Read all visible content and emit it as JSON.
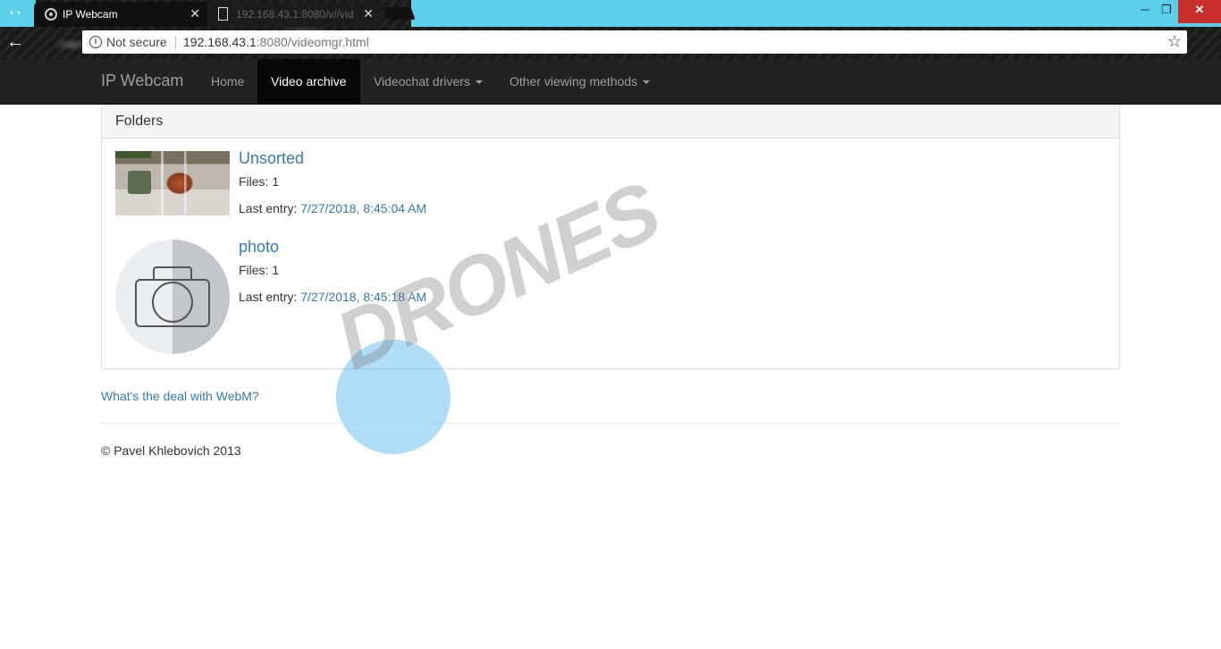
{
  "browser": {
    "tabs": [
      {
        "title": "IP Webcam",
        "active": true
      },
      {
        "title": "192.168.43.1:8080/v//vid",
        "active": false
      }
    ],
    "close_glyph": "✕",
    "address": {
      "security_label": "Not secure",
      "url_host": "192.168.43.1",
      "url_rest": ":8080/videomgr.html"
    },
    "icons": {
      "back": "arrow-left-icon",
      "info": "info-icon",
      "star": "star-icon",
      "favicon": "webcam-icon",
      "document": "document-icon"
    },
    "window_controls": {
      "minimize": "─",
      "maximize": "❐",
      "close": "✕"
    },
    "title_bar_color": "#5ccfea"
  },
  "navbar": {
    "brand": "IP Webcam",
    "items": [
      {
        "label": "Home",
        "active": false
      },
      {
        "label": "Video archive",
        "active": true
      },
      {
        "label": "Videochat drivers",
        "active": false,
        "dropdown": true
      },
      {
        "label": "Other viewing methods",
        "active": false,
        "dropdown": true
      }
    ]
  },
  "panel": {
    "title": "Folders",
    "folders": [
      {
        "name": "Unsorted",
        "files_label": "Files: 1",
        "last_entry_label": "Last entry:",
        "last_entry_date": "7/27/2018, 8:45:04 AM",
        "thumbnail": "video-thumbnail"
      },
      {
        "name": "photo",
        "files_label": "Files: 1",
        "last_entry_label": "Last entry:",
        "last_entry_date": "7/27/2018, 8:45:18 AM",
        "thumbnail": "camera-icon"
      }
    ]
  },
  "links": {
    "webm": "What's the deal with WebM?"
  },
  "footer": {
    "copyright": "© Pavel Khlebovich 2013"
  },
  "watermark": {
    "text": "DRONES"
  },
  "colors": {
    "link": "#337ab7",
    "navbar_bg": "#222222",
    "navbar_active": "#080808"
  }
}
